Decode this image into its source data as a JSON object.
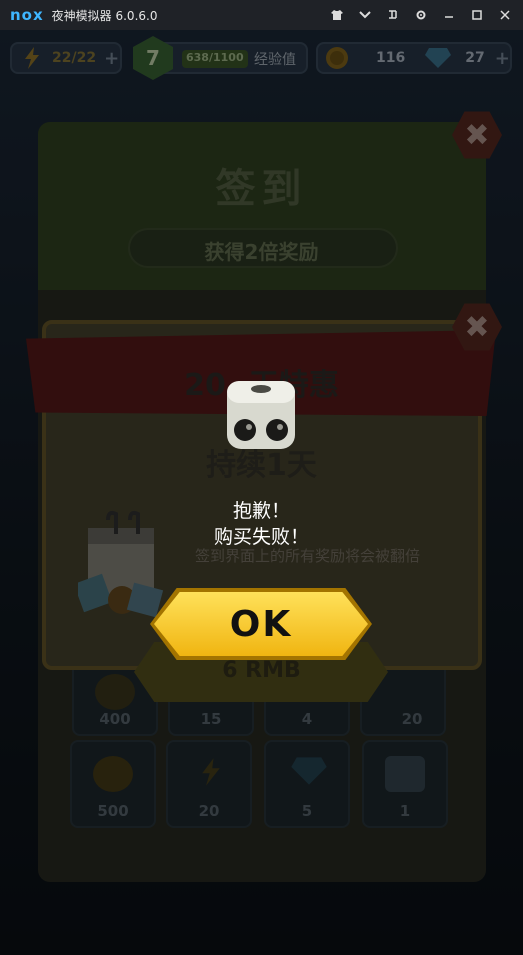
{
  "window": {
    "logo": "nox",
    "title": "夜神模拟器 6.0.6.0"
  },
  "hud": {
    "energy": "22/22",
    "level": "7",
    "xp": "638/1100",
    "xp_label": "经验值",
    "coins": "116",
    "gems": "27"
  },
  "signin": {
    "title": "签到",
    "subtitle": "获得2倍奖励",
    "tiles": [
      {
        "value": "400"
      },
      {
        "value": "15"
      },
      {
        "value": "4"
      },
      {
        "value": "20"
      },
      {
        "value": "500"
      },
      {
        "value": "20"
      },
      {
        "value": "5"
      },
      {
        "value": "1"
      }
    ]
  },
  "offer": {
    "title": "20 -天特惠",
    "subtitle": "持续1天",
    "description": "签到界面上的所有奖励将会被翻倍",
    "price": "6 RMB"
  },
  "dialog": {
    "line1": "抱歉！",
    "line2": "购买失败！",
    "ok": "OK"
  },
  "colors": {
    "ok_button": "#ffd633",
    "nox_brand": "#3fb6ff"
  }
}
